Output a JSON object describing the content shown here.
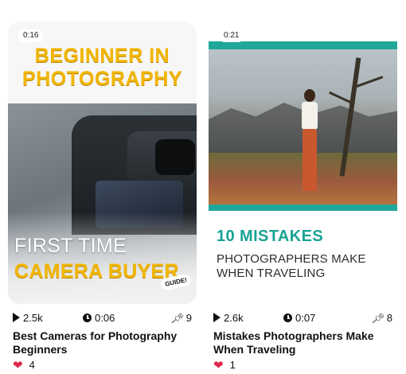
{
  "cards": [
    {
      "duration_badge": "0:16",
      "thumb_headline_1": "BEGINNER IN",
      "thumb_headline_2": "PHOTOGRAPHY",
      "thumb_line_1": "FIRST TIME",
      "thumb_line_2": "CAMERA BUYER",
      "thumb_sticker": "GUIDE!",
      "views": "2.5k",
      "duration": "0:06",
      "pins": "9",
      "title": "Best Cameras for Photography Beginners",
      "likes": "4"
    },
    {
      "duration_badge": "0:21",
      "thumb_line_1": "10 MISTAKES",
      "thumb_line_2": "PHOTOGRAPHERS MAKE WHEN TRAVELING",
      "views": "2.6k",
      "duration": "0:07",
      "pins": "8",
      "title": "Mistakes Photographers Make When Traveling",
      "likes": "1"
    }
  ],
  "icons": {
    "views": "play-icon",
    "duration": "clock-icon",
    "pins": "pin-icon",
    "likes": "heart-icon"
  },
  "colors": {
    "yellow_accent": "#f2b600",
    "teal_accent": "#1fa89a",
    "heart": "#e0254a"
  }
}
